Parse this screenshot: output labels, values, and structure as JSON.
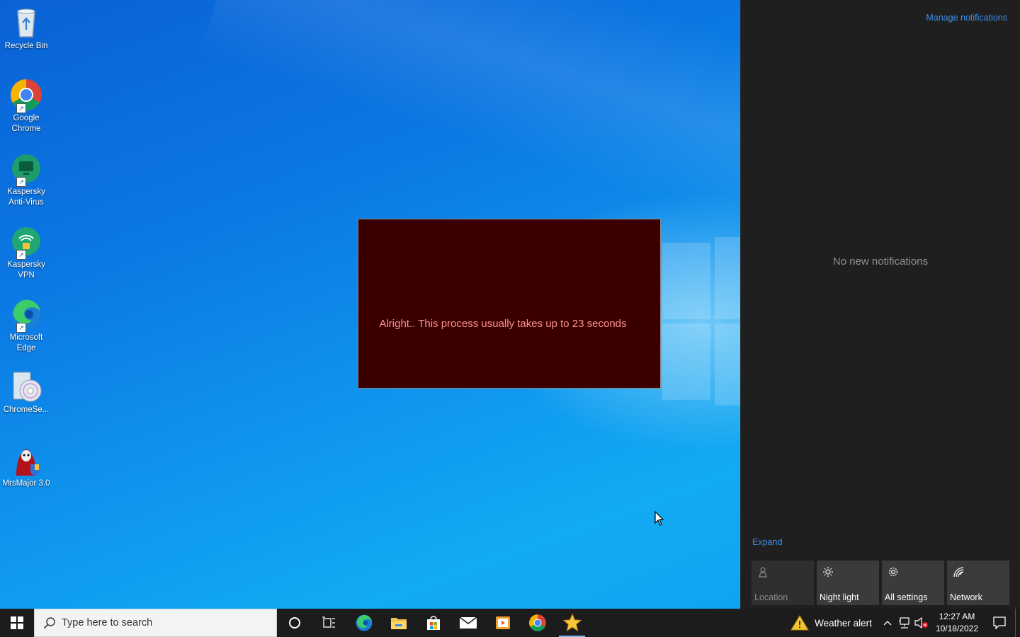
{
  "desktop": {
    "icons": [
      {
        "label": "Recycle Bin",
        "icon": "recycle-bin-icon"
      },
      {
        "label": "Google Chrome",
        "icon": "chrome-icon"
      },
      {
        "label": "Kaspersky Anti-Virus",
        "icon": "kaspersky-antivirus-icon"
      },
      {
        "label": "Kaspersky VPN",
        "icon": "kaspersky-vpn-icon"
      },
      {
        "label": "Microsoft Edge",
        "icon": "edge-icon"
      },
      {
        "label": "ChromeSe...",
        "icon": "setup-disc-icon"
      },
      {
        "label": "MrsMajor 3.0",
        "icon": "mrsmajor-icon"
      }
    ]
  },
  "dialog": {
    "message": "Alright.. This process usually takes up to 23 seconds",
    "background": "#3a0000",
    "text_color": "#ff9090"
  },
  "action_center": {
    "manage_link": "Manage notifications",
    "empty_text": "No new notifications",
    "expand_link": "Expand",
    "tiles": [
      {
        "label": "Location",
        "icon": "location-icon",
        "enabled": false
      },
      {
        "label": "Night light",
        "icon": "brightness-icon",
        "enabled": true
      },
      {
        "label": "All settings",
        "icon": "gear-icon",
        "enabled": true
      },
      {
        "label": "Network",
        "icon": "network-icon",
        "enabled": true
      }
    ]
  },
  "taskbar": {
    "search_placeholder": "Type here to search",
    "apps": [
      "cortana-icon",
      "task-view-icon",
      "edge-icon",
      "file-explorer-icon",
      "store-icon",
      "mail-icon",
      "media-icon",
      "chrome-icon",
      "star-app-icon"
    ],
    "weather_label": "Weather alert",
    "time": "12:27 AM",
    "date": "10/18/2022",
    "accent": "#7fb4e8"
  }
}
